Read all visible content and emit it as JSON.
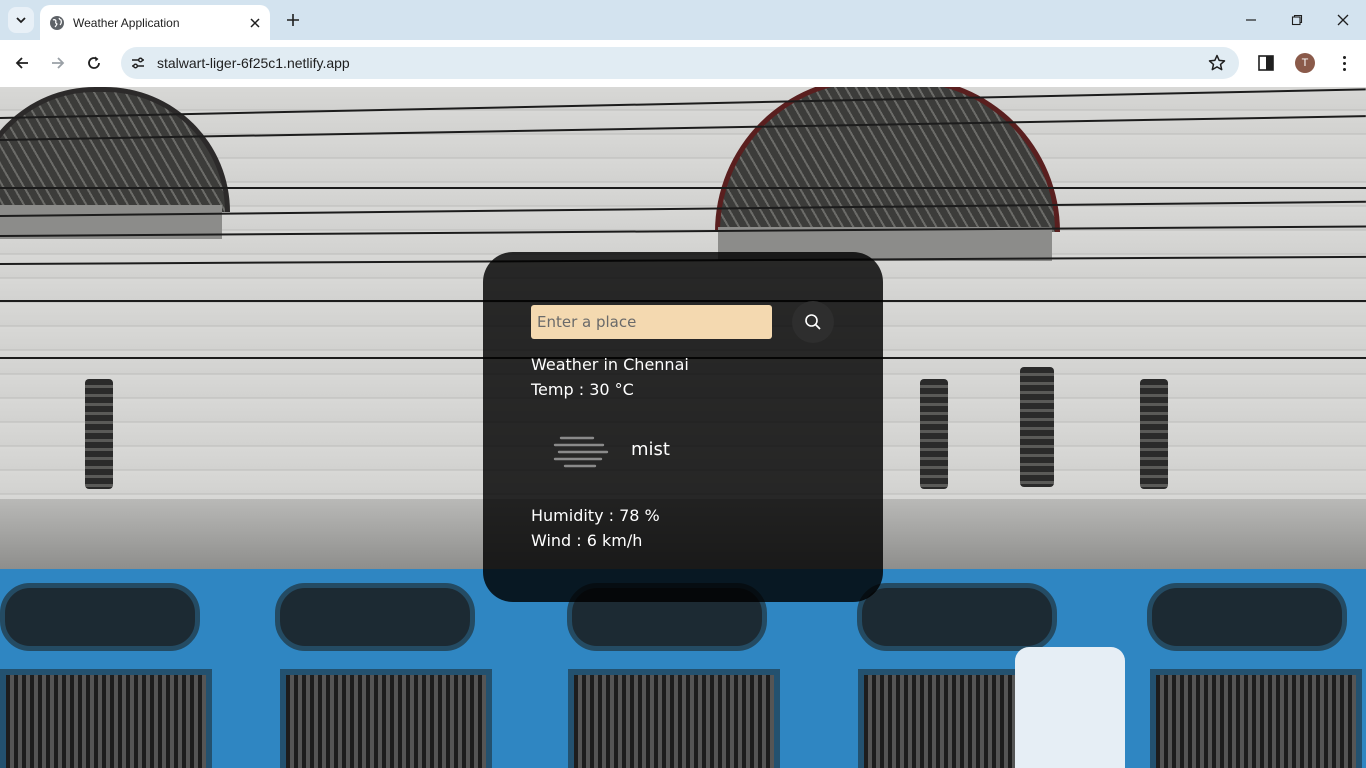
{
  "browser": {
    "tab_title": "Weather Application",
    "url": "stalwart-liger-6f25c1.netlify.app",
    "avatar_letter": "T"
  },
  "weather": {
    "search_placeholder": "Enter a place",
    "city_line": "Weather in Chennai",
    "temp_line": "Temp : 30 °C",
    "description": "mist",
    "humidity_line": "Humidity : 78 %",
    "wind_line": "Wind : 6 km/h",
    "icon": "mist-icon"
  },
  "colors": {
    "card_bg": "#000000",
    "input_bg": "#f4d9b0",
    "browser_frame": "#d3e3ef",
    "omnibox_bg": "#e1ecf3"
  }
}
